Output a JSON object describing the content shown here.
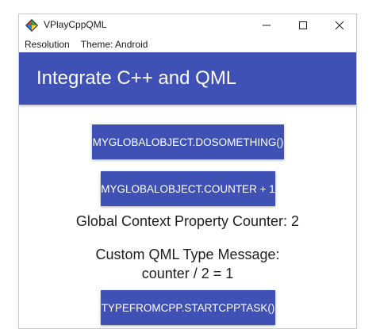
{
  "window": {
    "title": "VPlayCppQML",
    "icon": "vplay-diamond-icon"
  },
  "menubar": {
    "items": [
      {
        "label": "Resolution"
      },
      {
        "label": "Theme: Android"
      }
    ]
  },
  "appbar": {
    "title": "Integrate C++ and QML",
    "color": "#3f51b5"
  },
  "content": {
    "button_dosomething": "MYGLOBALOBJECT.DOSOMETHING()",
    "button_counter": "MYGLOBALOBJECT.COUNTER + 1",
    "counter_label": "Global Context Property Counter: 2",
    "custom_message_line1": "Custom QML Type Message:",
    "custom_message_line2": "counter / 2 = 1",
    "button_startcpptask": "TYPEFROMCPP.STARTCPPTASK()"
  }
}
